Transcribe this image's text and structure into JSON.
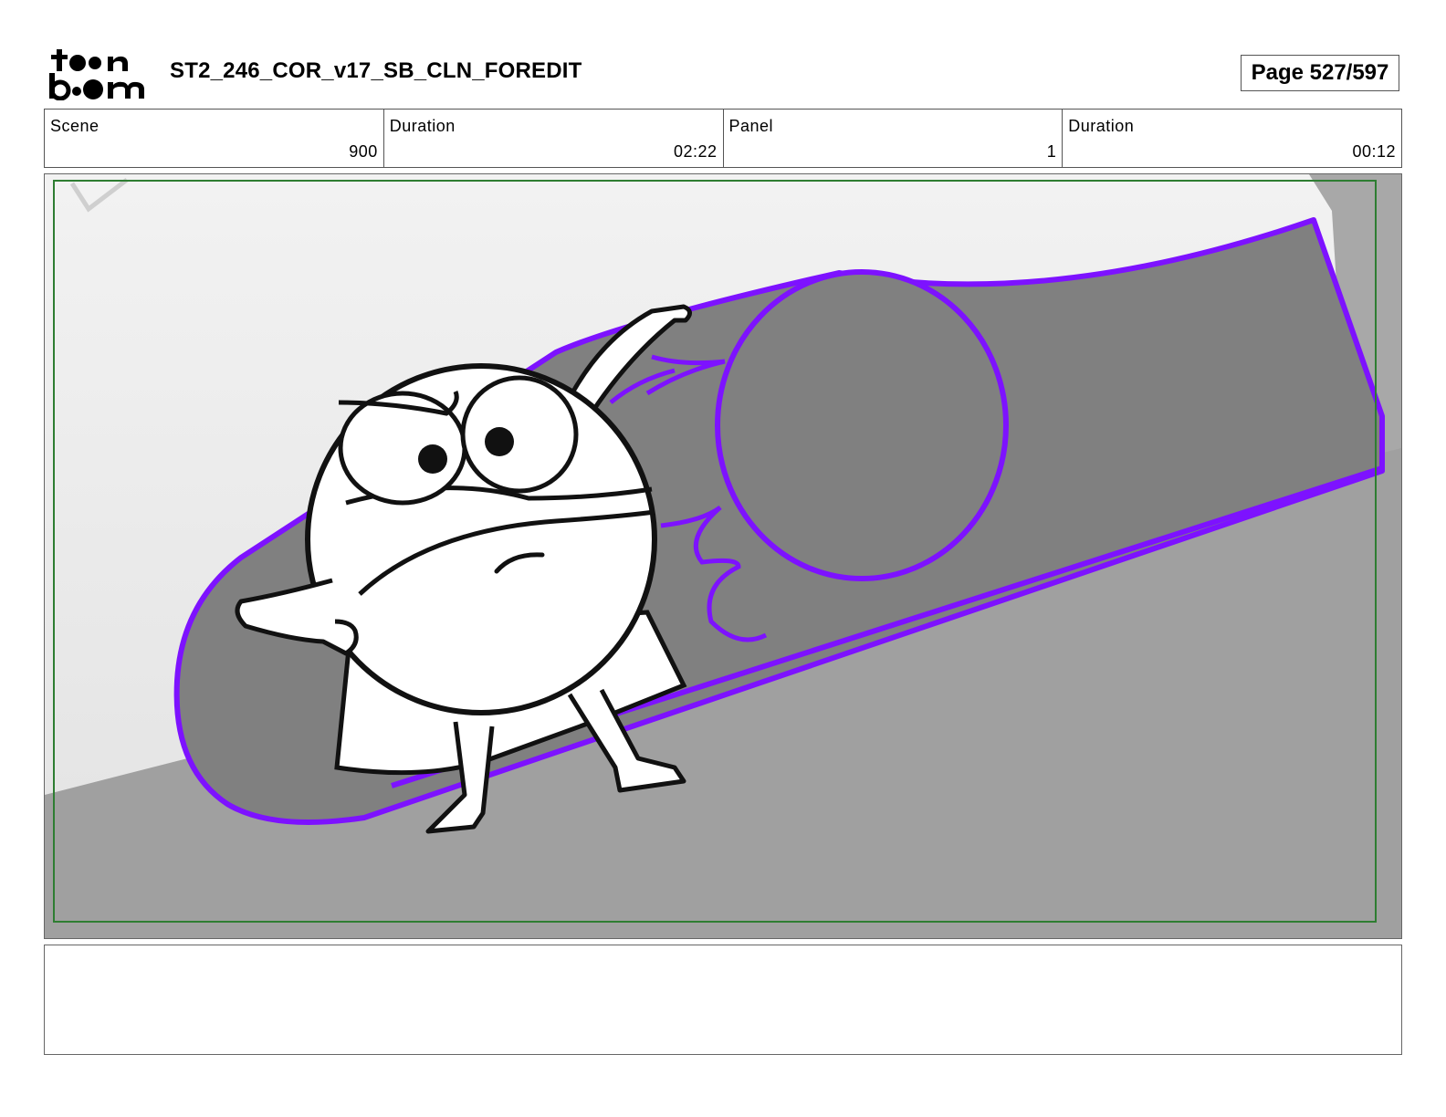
{
  "header": {
    "title": "ST2_246_COR_v17_SB_CLN_FOREDIT",
    "page": "Page 527/597"
  },
  "info": {
    "scene_label": "Scene",
    "scene_value": "900",
    "duration_label": "Duration",
    "duration_value": "02:22",
    "panel_label": "Panel",
    "panel_value": "1",
    "panel_duration_label": "Duration",
    "panel_duration_value": "00:12"
  },
  "colors": {
    "outline_purple": "#7d12ff",
    "safe_frame_green": "#2e7d32",
    "ground_gray": "#a0a0a0",
    "tube_gray": "#808080",
    "sky_light": "#eeeeee"
  },
  "notes": ""
}
